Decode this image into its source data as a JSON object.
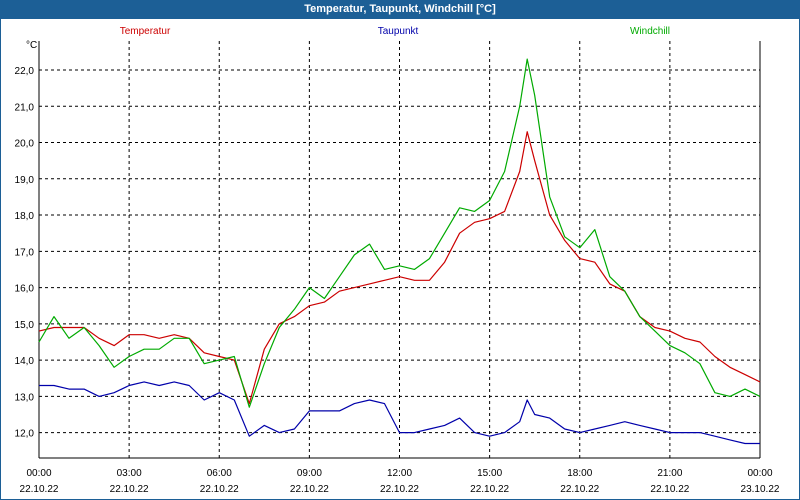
{
  "window": {
    "title": "Temperatur, Taupunkt, Windchill [°C]"
  },
  "chart_data": {
    "type": "line",
    "title": "Temperatur, Taupunkt, Windchill [°C]",
    "ylabel": "°C",
    "xlabel": "",
    "ylim": [
      11.3,
      22.8
    ],
    "xlim": [
      0,
      24
    ],
    "grid": true,
    "legend_position": "top",
    "y_ticks": [
      "12,0",
      "13,0",
      "14,0",
      "15,0",
      "16,0",
      "17,0",
      "18,0",
      "19,0",
      "20,0",
      "21,0",
      "22,0"
    ],
    "x_ticks": [
      {
        "time": "00:00",
        "date": "22.10.22"
      },
      {
        "time": "03:00",
        "date": "22.10.22"
      },
      {
        "time": "06:00",
        "date": "22.10.22"
      },
      {
        "time": "09:00",
        "date": "22.10.22"
      },
      {
        "time": "12:00",
        "date": "22.10.22"
      },
      {
        "time": "15:00",
        "date": "22.10.22"
      },
      {
        "time": "18:00",
        "date": "22.10.22"
      },
      {
        "time": "21:00",
        "date": "22.10.22"
      },
      {
        "time": "00:00",
        "date": "23.10.22"
      }
    ],
    "x": [
      0,
      0.5,
      1,
      1.5,
      2,
      2.5,
      3,
      3.5,
      4,
      4.5,
      5,
      5.5,
      6,
      6.5,
      7,
      7.5,
      8,
      8.5,
      9,
      9.5,
      10,
      10.5,
      11,
      11.5,
      12,
      12.5,
      13,
      13.5,
      14,
      14.5,
      15,
      15.5,
      16,
      16.25,
      16.5,
      17,
      17.5,
      18,
      18.5,
      19,
      19.5,
      20,
      20.5,
      21,
      21.5,
      22,
      22.5,
      23,
      23.5,
      24
    ],
    "series": [
      {
        "name": "Temperatur",
        "color": "#cc0000",
        "values": [
          14.8,
          14.9,
          14.9,
          14.9,
          14.6,
          14.4,
          14.7,
          14.7,
          14.6,
          14.7,
          14.6,
          14.2,
          14.1,
          14.0,
          12.8,
          14.3,
          15.0,
          15.2,
          15.5,
          15.6,
          15.9,
          16.0,
          16.1,
          16.2,
          16.3,
          16.2,
          16.2,
          16.7,
          17.5,
          17.8,
          17.9,
          18.1,
          19.2,
          20.3,
          19.5,
          18.0,
          17.3,
          16.8,
          16.7,
          16.1,
          15.9,
          15.2,
          14.9,
          14.8,
          14.6,
          14.5,
          14.1,
          13.8,
          13.6,
          13.4
        ]
      },
      {
        "name": "Taupunkt",
        "color": "#0000aa",
        "values": [
          13.3,
          13.3,
          13.2,
          13.2,
          13.0,
          13.1,
          13.3,
          13.4,
          13.3,
          13.4,
          13.3,
          12.9,
          13.1,
          12.9,
          11.9,
          12.2,
          12.0,
          12.1,
          12.6,
          12.6,
          12.6,
          12.8,
          12.9,
          12.8,
          12.0,
          12.0,
          12.1,
          12.2,
          12.4,
          12.0,
          11.9,
          12.0,
          12.3,
          12.9,
          12.5,
          12.4,
          12.1,
          12.0,
          12.1,
          12.2,
          12.3,
          12.2,
          12.1,
          12.0,
          12.0,
          12.0,
          11.9,
          11.8,
          11.7,
          11.7
        ]
      },
      {
        "name": "Windchill",
        "color": "#00aa00",
        "values": [
          14.5,
          15.2,
          14.6,
          14.9,
          14.4,
          13.8,
          14.1,
          14.3,
          14.3,
          14.6,
          14.6,
          13.9,
          14.0,
          14.1,
          12.7,
          13.9,
          14.9,
          15.4,
          16.0,
          15.7,
          16.3,
          16.9,
          17.2,
          16.5,
          16.6,
          16.5,
          16.8,
          17.5,
          18.2,
          18.1,
          18.4,
          19.2,
          21.0,
          22.3,
          21.3,
          18.5,
          17.4,
          17.1,
          17.6,
          16.3,
          15.9,
          15.2,
          14.8,
          14.4,
          14.2,
          13.9,
          13.1,
          13.0,
          13.2,
          13.0
        ]
      }
    ]
  }
}
